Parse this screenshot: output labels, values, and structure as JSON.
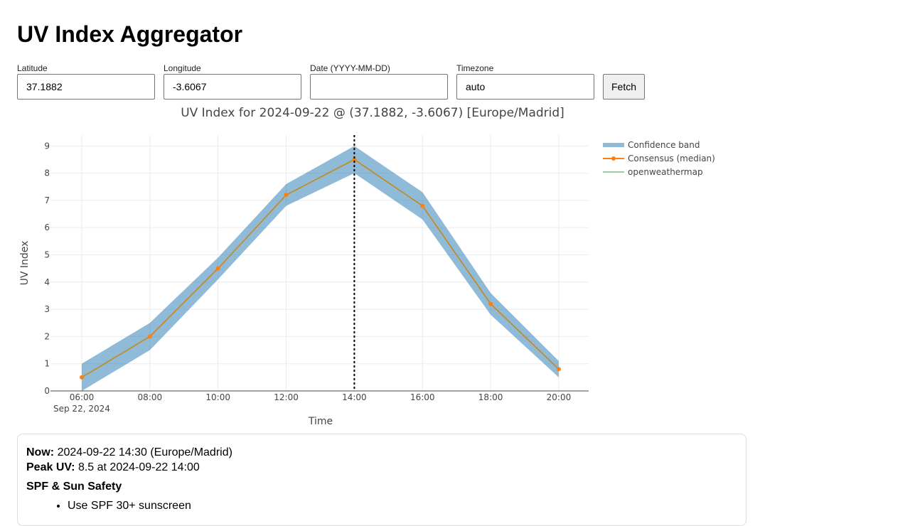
{
  "app": {
    "title": "UV Index Aggregator"
  },
  "form": {
    "latitude": {
      "label": "Latitude",
      "value": "37.1882"
    },
    "longitude": {
      "label": "Longitude",
      "value": "-3.6067"
    },
    "date": {
      "label": "Date (YYYY-MM-DD)",
      "value": ""
    },
    "timezone": {
      "label": "Timezone",
      "value": "auto"
    },
    "fetch_label": "Fetch"
  },
  "colors": {
    "band": "#1f77b4",
    "consensus": "#ff7f0e",
    "openweathermap": "#2ca02c",
    "now_line": "#000000"
  },
  "chart_data": {
    "type": "line",
    "title": "UV Index for 2024-09-22 @ (37.1882, -3.6067) [Europe/Madrid]",
    "xlabel": "Time",
    "ylabel": "UV Index",
    "x": [
      "06:00",
      "08:00",
      "10:00",
      "12:00",
      "14:00",
      "16:00",
      "18:00",
      "20:00"
    ],
    "x_date_label": "Sep 22, 2024",
    "ylim": [
      0,
      9.4
    ],
    "yticks": [
      0,
      1,
      2,
      3,
      4,
      5,
      6,
      7,
      8,
      9
    ],
    "grid": true,
    "legend_position": "top-right",
    "now_marker": "14:00",
    "series": [
      {
        "name": "Confidence band",
        "kind": "band",
        "upper": [
          1.0,
          2.5,
          4.9,
          7.6,
          9.0,
          7.3,
          3.6,
          1.1
        ],
        "lower": [
          0.0,
          1.5,
          4.1,
          6.8,
          8.0,
          6.3,
          2.8,
          0.5
        ]
      },
      {
        "name": "Consensus (median)",
        "kind": "line",
        "values": [
          0.5,
          2.0,
          4.5,
          7.2,
          8.5,
          6.8,
          3.2,
          0.8
        ]
      },
      {
        "name": "openweathermap",
        "kind": "line",
        "values": [
          0.5,
          2.0,
          4.5,
          7.2,
          8.5,
          6.8,
          3.2,
          0.8
        ]
      }
    ]
  },
  "summary": {
    "now_label": "Now:",
    "now_value": "2024-09-22 14:30 (Europe/Madrid)",
    "peak_label": "Peak UV:",
    "peak_value": "8.5 at 2024-09-22 14:00",
    "spf_heading": "SPF & Sun Safety",
    "tips": [
      "Use SPF 30+ sunscreen"
    ]
  }
}
